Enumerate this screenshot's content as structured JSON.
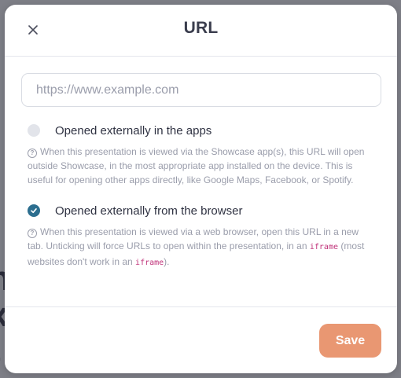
{
  "dialog": {
    "title": "URL",
    "close_icon": "close-icon"
  },
  "url_field": {
    "value": "",
    "placeholder": "https://www.example.com"
  },
  "options": [
    {
      "label": "Opened externally in the apps",
      "checked": false,
      "help_icon": "question-circle-icon",
      "help_text": "When this presentation is viewed via the Showcase app(s), this URL will open outside Showcase, in the most appropriate app installed on the device. This is useful for opening other apps directly, like Google Maps, Facebook, or Spotify."
    },
    {
      "label": "Opened externally from the browser",
      "checked": true,
      "help_icon": "question-circle-icon",
      "help_text_before": "When this presentation is viewed via a web browser, open this URL in a new tab. Unticking will force URLs to open within the presentation, in an",
      "help_code_1": "iframe",
      "help_text_middle": "(most websites don't work in an",
      "help_code_2": "iframe",
      "help_text_after": ")."
    }
  ],
  "footer": {
    "save_label": "Save"
  },
  "colors": {
    "accent_checked": "#2c6e8f",
    "save_button": "#e99772",
    "code_text": "#c0337a"
  }
}
